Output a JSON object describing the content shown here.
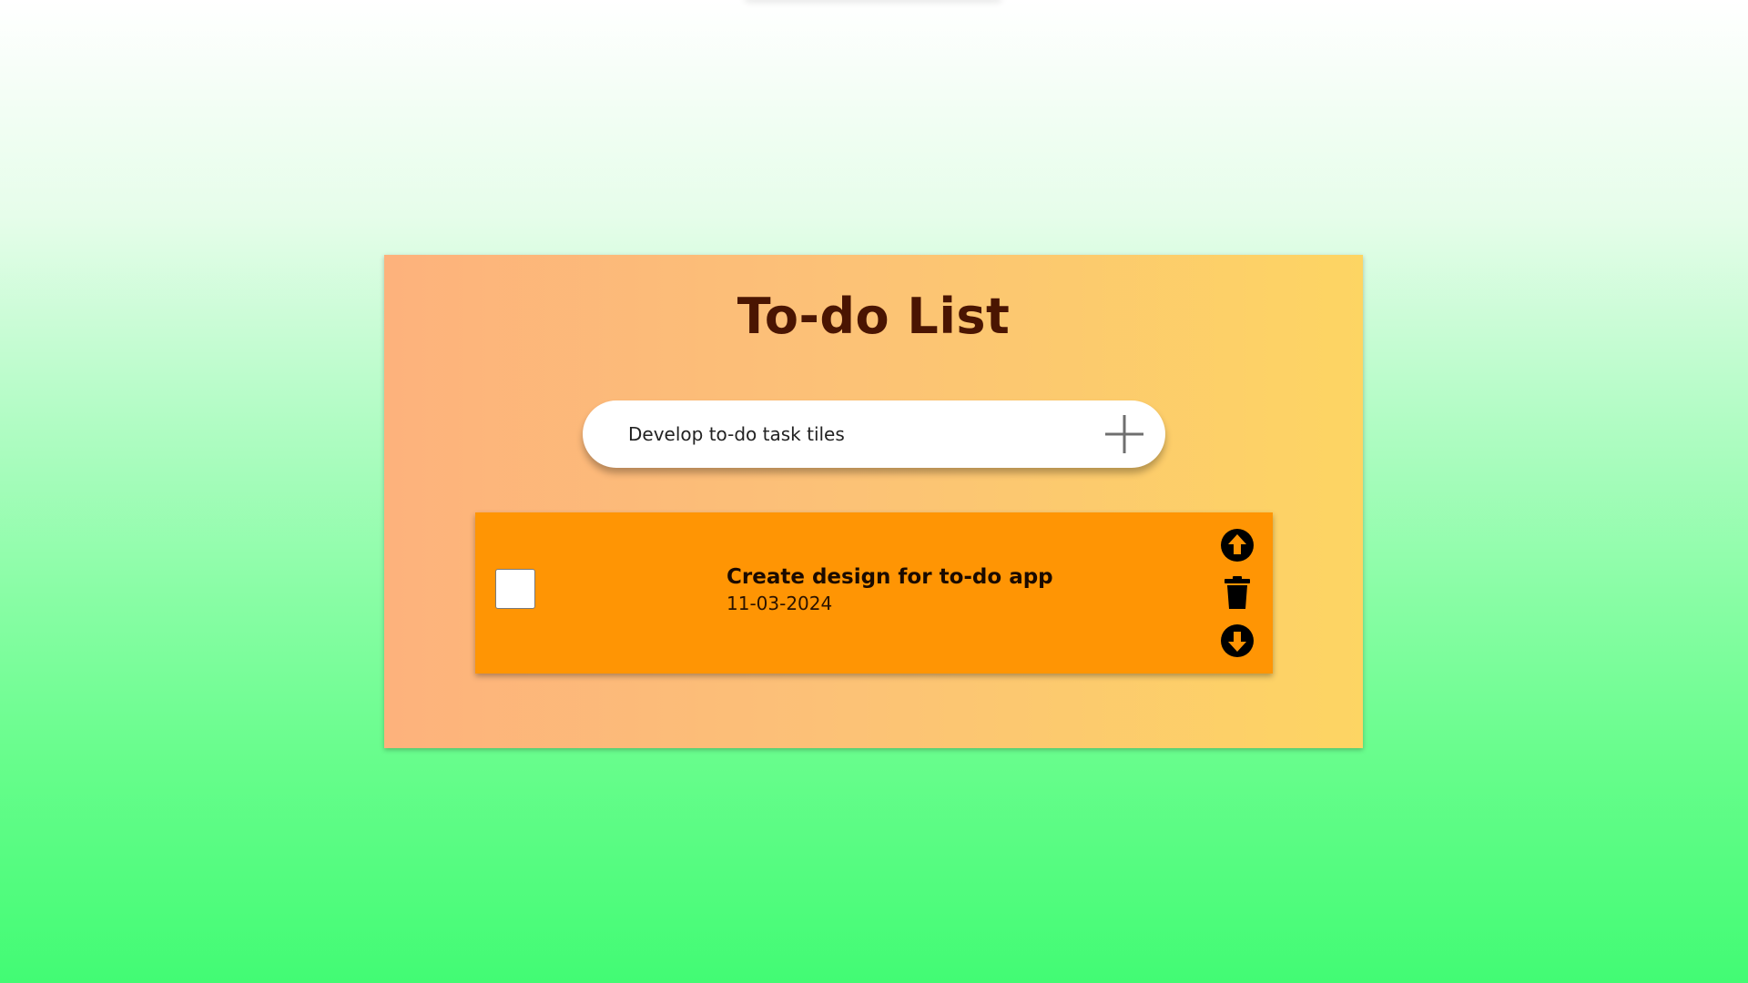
{
  "app": {
    "title": "To-do List"
  },
  "new_task": {
    "value": "Develop to-do task tiles",
    "add_icon": "plus-icon"
  },
  "tasks": [
    {
      "name": "Create design for to-do app",
      "date": "11-03-2024",
      "checked": false,
      "icons": [
        "arrow-up-circle-icon",
        "trash-icon",
        "arrow-down-circle-icon"
      ]
    }
  ],
  "colors": {
    "title": "#4a1502",
    "tile": "#ff9504",
    "card_gradient_start": "#fdb27c",
    "card_gradient_end": "#fdd563",
    "background_top": "#ffffff",
    "background_bottom": "#42fb74"
  }
}
